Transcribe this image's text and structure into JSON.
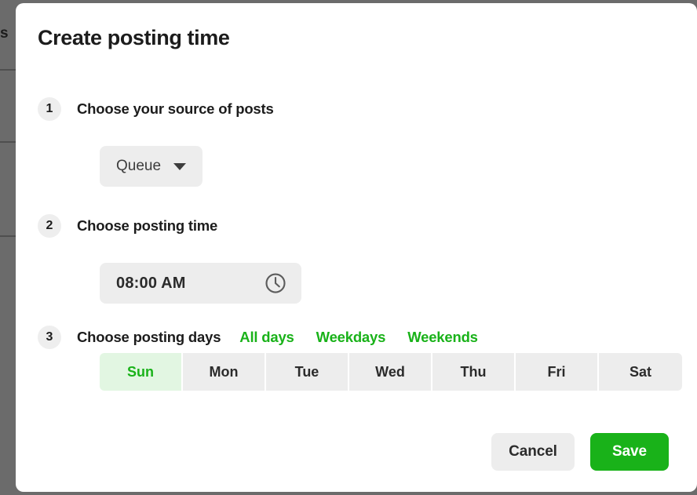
{
  "backdrop": {
    "partial_text": "s",
    "overlay_color": "#6b6b6b"
  },
  "modal": {
    "title": "Create posting time",
    "accent_color": "#19b219",
    "steps": [
      {
        "number": "1",
        "title": "Choose your source of posts"
      },
      {
        "number": "2",
        "title": "Choose posting time"
      },
      {
        "number": "3",
        "title": "Choose posting days"
      }
    ],
    "source_select": {
      "value": "Queue",
      "icon": "chevron-down-icon"
    },
    "time_field": {
      "value": "08:00 AM",
      "icon": "clock-icon"
    },
    "quick_links": [
      {
        "label": "All days"
      },
      {
        "label": "Weekdays"
      },
      {
        "label": "Weekends"
      }
    ],
    "days": [
      {
        "label": "Sun",
        "selected": true
      },
      {
        "label": "Mon",
        "selected": false
      },
      {
        "label": "Tue",
        "selected": false
      },
      {
        "label": "Wed",
        "selected": false
      },
      {
        "label": "Thu",
        "selected": false
      },
      {
        "label": "Fri",
        "selected": false
      },
      {
        "label": "Sat",
        "selected": false
      }
    ],
    "footer": {
      "cancel_label": "Cancel",
      "save_label": "Save"
    }
  }
}
